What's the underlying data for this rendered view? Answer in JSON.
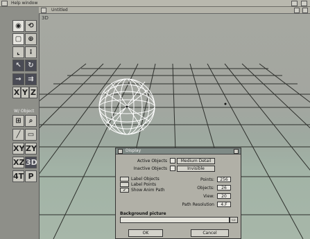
{
  "window": {
    "title": "Help window"
  },
  "subwindow": {
    "title": "Untitled"
  },
  "viewport": {
    "mode_label": "3D"
  },
  "toolbar": {
    "caption": "W/ Object",
    "axis_buttons": [
      "X",
      "Y",
      "Z"
    ],
    "plane_buttons": [
      "XY",
      "ZY",
      "XZ",
      "3D"
    ],
    "misc_buttons": [
      "4T",
      "P"
    ]
  },
  "dialog": {
    "title": "Display",
    "active_objects_label": "Active Objects",
    "active_objects_value": "Medium Detail",
    "inactive_objects_label": "Inactive Objects",
    "inactive_objects_value": "Invisible",
    "checkbox_label_objects": "Label Objects",
    "checkbox_label_points": "Label Points",
    "checkbox_show_anim_path": "Show Anim Path",
    "points_label": "Points:",
    "points_value": "256",
    "objects_label": "Objects:",
    "objects_value": "26",
    "view_label": "View:",
    "view_value": "20",
    "path_resolution_label": "Path Resolution",
    "path_resolution_value": "4.F",
    "background_label": "Background picture",
    "ok_label": "OK",
    "cancel_label": "Cancel"
  },
  "colors": {
    "toolbar_bg": "#8e8f89",
    "dialog_bg": "#b1b0a7",
    "wireframe": "#ffffff"
  }
}
